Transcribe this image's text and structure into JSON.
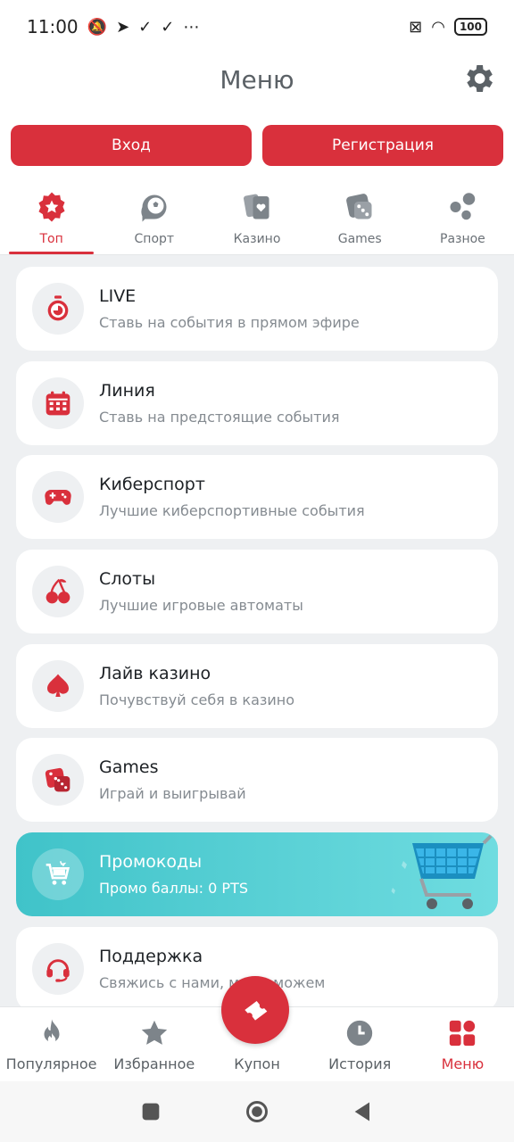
{
  "status_bar": {
    "time": "11:00",
    "icons_left": [
      "mute-icon",
      "telegram-icon",
      "check-icon",
      "check-icon",
      "more-icon"
    ],
    "battery": "100"
  },
  "header": {
    "title": "Меню"
  },
  "auth": {
    "login": "Вход",
    "register": "Регистрация"
  },
  "tabs": [
    {
      "label": "Топ",
      "icon": "star-badge-icon",
      "active": true
    },
    {
      "label": "Спорт",
      "icon": "ball-icon"
    },
    {
      "label": "Казино",
      "icon": "cards-icon"
    },
    {
      "label": "Games",
      "icon": "dice-icon"
    },
    {
      "label": "Разное",
      "icon": "dots-icon"
    }
  ],
  "menu": [
    {
      "title": "LIVE",
      "subtitle": "Ставь на события в прямом эфире",
      "icon": "stopwatch-icon"
    },
    {
      "title": "Линия",
      "subtitle": "Ставь на предстоящие события",
      "icon": "calendar-icon"
    },
    {
      "title": "Киберспорт",
      "subtitle": "Лучшие киберспортивные события",
      "icon": "gamepad-icon"
    },
    {
      "title": "Слоты",
      "subtitle": "Лучшие игровые автоматы",
      "icon": "cherries-icon"
    },
    {
      "title": "Лайв казино",
      "subtitle": "Почувствуй себя в казино",
      "icon": "spade-icon"
    },
    {
      "title": "Games",
      "subtitle": "Играй и выигрывай",
      "icon": "dice-icon"
    },
    {
      "title": "Промокоды",
      "subtitle": "Промо баллы: 0 PTS",
      "icon": "cart-icon"
    },
    {
      "title": "Поддержка",
      "subtitle": "Свяжись с нами, мы поможем",
      "icon": "headset-icon"
    }
  ],
  "bottom_nav": [
    {
      "label": "Популярное",
      "icon": "fire-icon"
    },
    {
      "label": "Избранное",
      "icon": "star-icon"
    },
    {
      "label": "Купон",
      "icon": "ticket-icon"
    },
    {
      "label": "История",
      "icon": "clock-icon"
    },
    {
      "label": "Меню",
      "icon": "grid-icon",
      "active": true
    }
  ],
  "colors": {
    "accent": "#d9303c",
    "promo": "#40c3c9",
    "background": "#eef0f2"
  }
}
